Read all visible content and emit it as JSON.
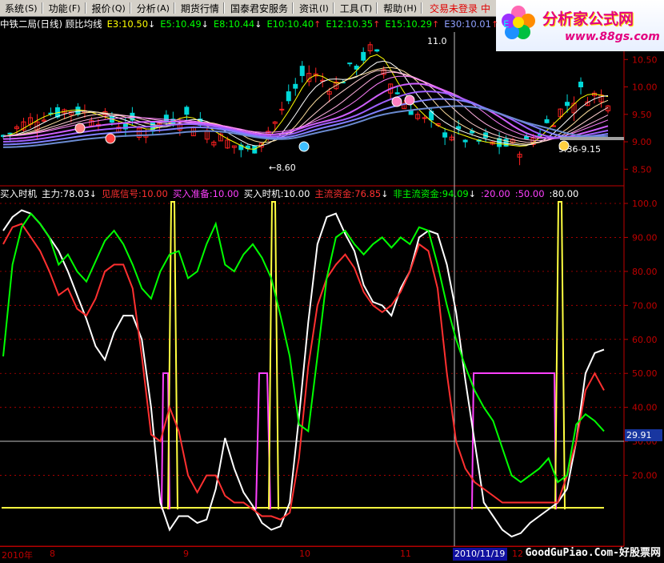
{
  "menu": {
    "items": [
      {
        "label": "系统",
        "sc": "(S)"
      },
      {
        "label": "功能",
        "sc": "(F)"
      },
      {
        "label": "报价",
        "sc": "(Q)"
      },
      {
        "label": "分析",
        "sc": "(A)"
      },
      {
        "label": "期货行情",
        "sc": ""
      },
      {
        "label": "国泰君安服务",
        "sc": ""
      },
      {
        "label": "资讯",
        "sc": "(I)"
      },
      {
        "label": "工具",
        "sc": "(T)"
      },
      {
        "label": "帮助",
        "sc": "(H)"
      }
    ],
    "login": "交易未登录",
    "middle": "中"
  },
  "logo": {
    "brand": "分析家公式网",
    "url": "www.88gs.com"
  },
  "top_indicator": {
    "title": "中铁二局(日线) 顾比均线",
    "items": [
      {
        "label": "E3:10.50",
        "arrow": "↓",
        "color": "#ffff00"
      },
      {
        "label": "E5:10.49",
        "arrow": "↓",
        "color": "#00ff00"
      },
      {
        "label": "E8:10.44",
        "arrow": "↓",
        "color": "#00ff00"
      },
      {
        "label": "E10:10.40",
        "arrow": "↑",
        "color": "#00ff00"
      },
      {
        "label": "E12:10.35",
        "arrow": "↑",
        "color": "#00ff00"
      },
      {
        "label": "E15:10.29",
        "arrow": "↑",
        "color": "#00ff00"
      },
      {
        "label": "E30:10.01",
        "arrow": "↑",
        "color": "#8fa0ff"
      },
      {
        "label": "E",
        "arrow": "",
        "color": "#00ffff"
      }
    ]
  },
  "price_axis": [
    "10.50",
    "10.00",
    "9.50",
    "9.00",
    "8.50"
  ],
  "price_annotations": {
    "high": "11.0",
    "low": "8.60",
    "range": "9.36-9.15"
  },
  "bottom_indicator": {
    "title": "买入时机",
    "items": [
      {
        "label": "主力:78.03",
        "arrow": "↓",
        "color": "#ffffff"
      },
      {
        "label": "见底信号:10.00",
        "arrow": "",
        "color": "#ff3030"
      },
      {
        "label": "买入准备:10.00",
        "arrow": "",
        "color": "#ff40ff"
      },
      {
        "label": "买入时机:10.00",
        "arrow": "",
        "color": "#ffffff"
      },
      {
        "label": "主流资金:76.85",
        "arrow": "↓",
        "color": "#ff3030"
      },
      {
        "label": "非主流资金:94.09",
        "arrow": "↓",
        "color": "#00ff00"
      },
      {
        "label": ":20.00",
        "arrow": "",
        "color": "#ff40ff"
      },
      {
        "label": ":50.00",
        "arrow": "",
        "color": "#ff40ff"
      },
      {
        "label": ":80.00",
        "arrow": "",
        "color": "#ffffff"
      }
    ]
  },
  "osc_axis": [
    "100.0",
    "90.00",
    "80.00",
    "70.00",
    "60.00",
    "50.00",
    "40.00",
    "30.00",
    "20.00"
  ],
  "cursor_value": "29.91",
  "date_axis": {
    "ticks": [
      {
        "label": "2010年"
      },
      {
        "label": "8"
      },
      {
        "label": "9"
      },
      {
        "label": "10"
      },
      {
        "label": "11"
      },
      {
        "label": "12"
      }
    ],
    "selected": "2010/11/19"
  },
  "watermark": "GoodGuPiao.Com-好股票网",
  "chart_data": {
    "type": "line",
    "series": [
      {
        "name": "主力",
        "color": "#ffffff",
        "values": [
          92,
          96,
          98,
          97,
          94,
          90,
          86,
          80,
          73,
          66,
          58,
          54,
          62,
          67,
          67,
          60,
          40,
          12,
          4,
          8,
          8,
          6,
          7,
          16,
          31,
          22,
          15,
          11,
          6,
          4,
          5,
          12,
          37,
          65,
          88,
          96,
          97,
          91,
          86,
          76,
          71,
          70,
          67,
          75,
          80,
          90,
          92,
          91,
          82,
          68,
          48,
          30,
          12,
          8,
          4,
          2,
          3,
          6,
          8,
          10,
          12,
          16,
          30,
          50,
          56,
          57
        ]
      },
      {
        "name": "主流资金",
        "color": "#ff3030",
        "values": [
          88,
          93,
          94,
          90,
          86,
          80,
          73,
          75,
          69,
          67,
          72,
          80,
          82,
          82,
          75,
          55,
          32,
          30,
          40,
          33,
          20,
          15,
          20,
          20,
          14,
          12,
          12,
          10,
          8,
          8,
          7,
          9,
          25,
          52,
          70,
          78,
          82,
          85,
          81,
          74,
          70,
          68,
          70,
          74,
          80,
          88,
          86,
          75,
          50,
          30,
          22,
          18,
          16,
          14,
          12,
          12,
          12,
          12,
          12,
          12,
          12,
          20,
          30,
          45,
          50,
          45
        ]
      },
      {
        "name": "非主流资金",
        "color": "#00ff00",
        "values": [
          55,
          82,
          93,
          97,
          94,
          90,
          82,
          85,
          80,
          77,
          83,
          89,
          92,
          88,
          82,
          75,
          72,
          80,
          85,
          86,
          78,
          80,
          88,
          94,
          82,
          80,
          85,
          88,
          84,
          78,
          67,
          55,
          35,
          33,
          55,
          78,
          90,
          92,
          88,
          85,
          88,
          90,
          87,
          90,
          88,
          93,
          92,
          82,
          70,
          60,
          52,
          45,
          40,
          36,
          28,
          20,
          18,
          20,
          22,
          25,
          18,
          20,
          35,
          38,
          36,
          33
        ]
      }
    ],
    "reference_lines": [
      20,
      50,
      80
    ],
    "y_range": [
      0,
      100
    ],
    "price_range": [
      8.3,
      11.0
    ]
  }
}
